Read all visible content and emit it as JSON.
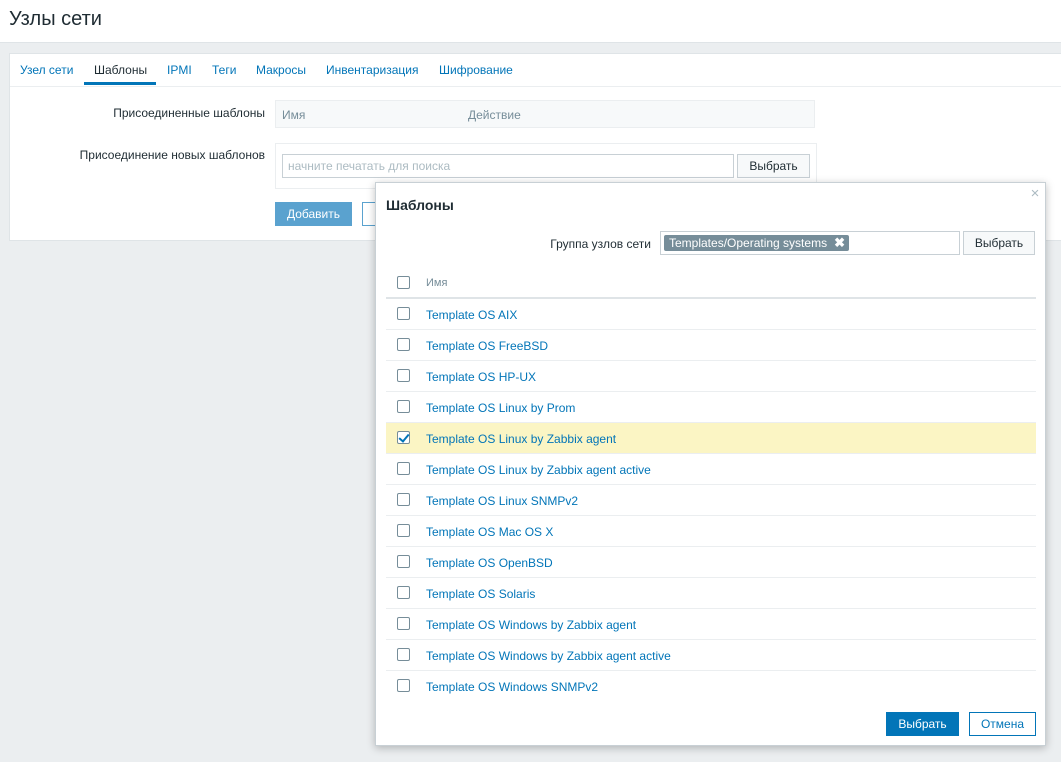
{
  "page": {
    "title": "Узлы сети"
  },
  "tabs": [
    {
      "label": "Узел сети"
    },
    {
      "label": "Шаблоны",
      "active": true
    },
    {
      "label": "IPMI"
    },
    {
      "label": "Теги"
    },
    {
      "label": "Макросы"
    },
    {
      "label": "Инвентаризация"
    },
    {
      "label": "Шифрование"
    }
  ],
  "form": {
    "linked_label": "Присоединенные шаблоны",
    "linked_columns": {
      "name": "Имя",
      "action": "Действие"
    },
    "link_new_label": "Присоединение новых шаблонов",
    "search_placeholder": "начните печатать для поиска",
    "select_button": "Выбрать",
    "add_button": "Добавить"
  },
  "dialog": {
    "title": "Шаблоны",
    "close_glyph": "×",
    "filter_label": "Группа узлов сети",
    "filter_chip": "Templates/Operating systems",
    "filter_chip_remove": "✖",
    "filter_select_button": "Выбрать",
    "column_name": "Имя",
    "items": [
      {
        "name": "Template OS AIX",
        "checked": false
      },
      {
        "name": "Template OS FreeBSD",
        "checked": false
      },
      {
        "name": "Template OS HP-UX",
        "checked": false
      },
      {
        "name": "Template OS Linux by Prom",
        "checked": false
      },
      {
        "name": "Template OS Linux by Zabbix agent",
        "checked": true
      },
      {
        "name": "Template OS Linux by Zabbix agent active",
        "checked": false
      },
      {
        "name": "Template OS Linux SNMPv2",
        "checked": false
      },
      {
        "name": "Template OS Mac OS X",
        "checked": false
      },
      {
        "name": "Template OS OpenBSD",
        "checked": false
      },
      {
        "name": "Template OS Solaris",
        "checked": false
      },
      {
        "name": "Template OS Windows by Zabbix agent",
        "checked": false
      },
      {
        "name": "Template OS Windows by Zabbix agent active",
        "checked": false
      },
      {
        "name": "Template OS Windows SNMPv2",
        "checked": false
      }
    ],
    "select_button": "Выбрать",
    "cancel_button": "Отмена"
  },
  "colors": {
    "accent": "#0275b8",
    "selected_row": "#fbf5c4",
    "chip": "#768d99",
    "background": "#ebeef0"
  }
}
